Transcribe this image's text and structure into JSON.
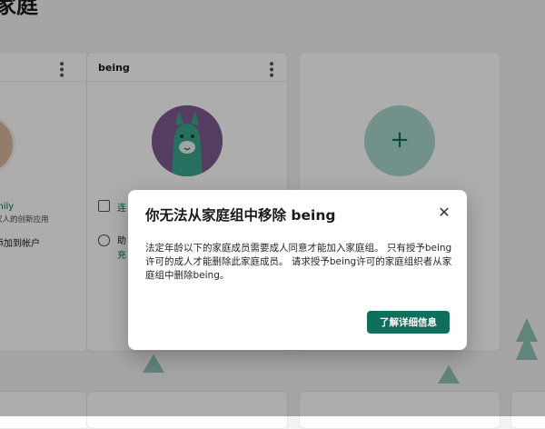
{
  "page": {
    "title": "家庭"
  },
  "cards": {
    "left": {
      "name_partial": "mily",
      "desc_partial": "家人的创新应用",
      "link_partial": "添加到帐户"
    },
    "being": {
      "name": "being",
      "row1_partial": "连",
      "row2_partial": "助",
      "row2_sub_partial": "充"
    },
    "add": {
      "plus": "+"
    }
  },
  "dialog": {
    "title": "你无法从家庭组中移除 being",
    "close_glyph": "✕",
    "body": "法定年龄以下的家庭成员需要成人同意才能加入家庭组。 只有授予being许可的成人才能删除此家庭成员。 请求授予being许可的家庭组织者从家庭组中删除being。",
    "button_label": "了解详细信息"
  },
  "colors": {
    "accent": "#0f6e5c",
    "overlay": "rgba(0,0,0,0.32)",
    "tree": "#8fc3b5"
  },
  "icons": {
    "more": "more-vertical-icon",
    "close": "close-icon",
    "plus": "plus-icon"
  }
}
